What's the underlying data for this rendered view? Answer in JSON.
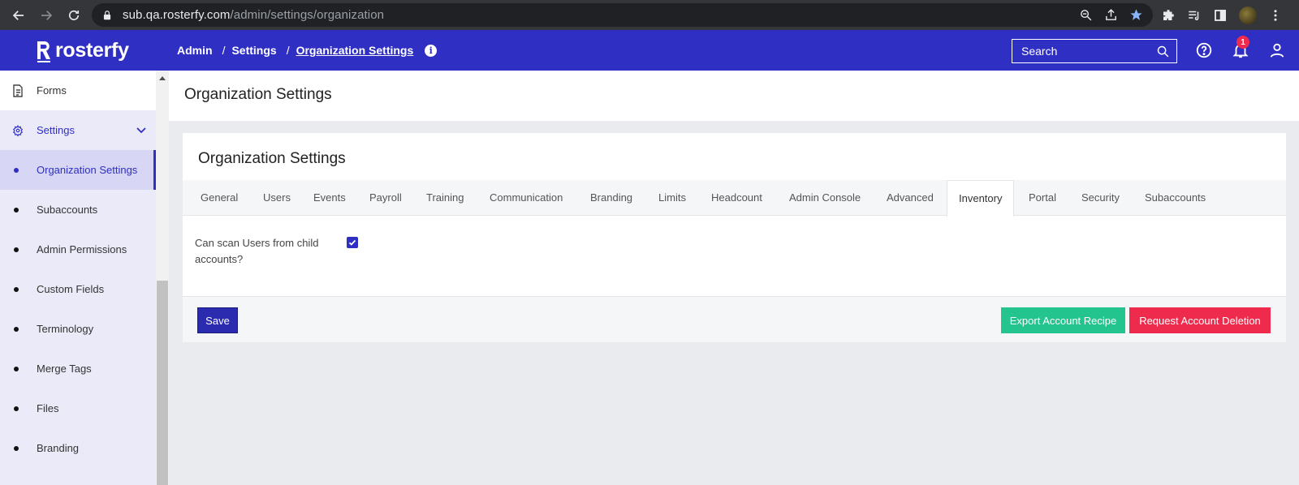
{
  "browser": {
    "url_host": "sub.qa.rosterfy.com",
    "url_path": "/admin/settings/organization"
  },
  "header": {
    "logo_text": "rosterfy",
    "breadcrumb": [
      "Admin",
      "Settings",
      "Organization Settings"
    ],
    "breadcrumb_sep": "/",
    "search_placeholder": "Search",
    "notification_count": "1",
    "brand_color": "#2f2fc4"
  },
  "sidebar": {
    "items": [
      {
        "label": "Forms",
        "icon": "document-icon"
      },
      {
        "label": "Settings",
        "icon": "gear-icon"
      },
      {
        "label": "Organization Settings",
        "active": true
      },
      {
        "label": "Subaccounts"
      },
      {
        "label": "Admin Permissions"
      },
      {
        "label": "Custom Fields"
      },
      {
        "label": "Terminology"
      },
      {
        "label": "Merge Tags"
      },
      {
        "label": "Files"
      },
      {
        "label": "Branding"
      }
    ]
  },
  "main": {
    "page_title": "Organization Settings",
    "card_title": "Organization Settings",
    "tabs": [
      "General",
      "Users",
      "Events",
      "Payroll",
      "Training",
      "Communication",
      "Branding",
      "Limits",
      "Headcount",
      "Admin Console",
      "Advanced",
      "Inventory",
      "Portal",
      "Security",
      "Subaccounts"
    ],
    "active_tab": "Inventory",
    "field": {
      "label": "Can scan Users from child accounts?",
      "checked": true
    },
    "buttons": {
      "save": "Save",
      "export": "Export Account Recipe",
      "delete": "Request Account Deletion"
    },
    "colors": {
      "save": "#2b2bb0",
      "export": "#23c48e",
      "delete": "#ee2b4c"
    }
  }
}
